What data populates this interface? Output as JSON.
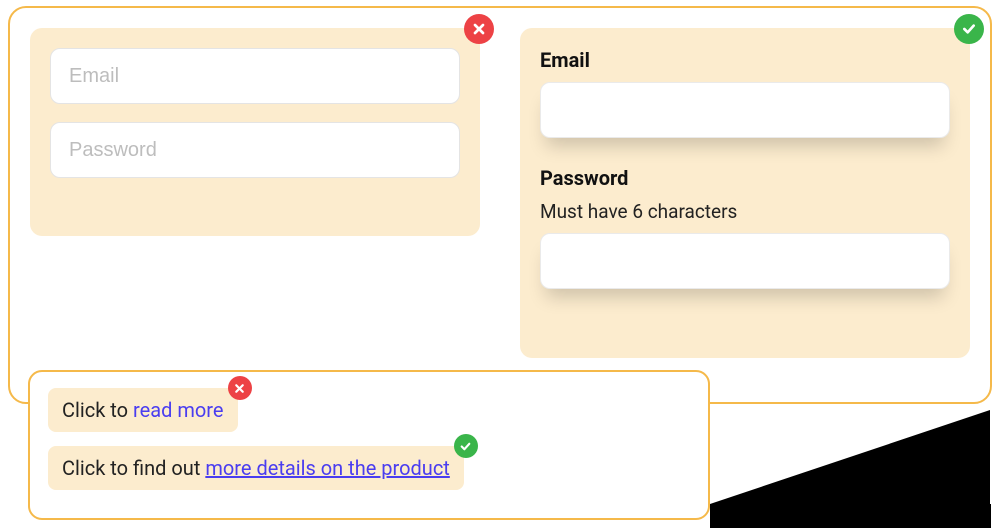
{
  "badExample": {
    "emailPlaceholder": "Email",
    "passwordPlaceholder": "Password"
  },
  "goodExample": {
    "emailLabel": "Email",
    "passwordLabel": "Password",
    "passwordHint": "Must have 6 characters"
  },
  "links": {
    "bad": {
      "prefix": "Click to ",
      "linkText": "read more"
    },
    "good": {
      "prefix": "Click to find out ",
      "linkText": "more details on the product"
    }
  }
}
